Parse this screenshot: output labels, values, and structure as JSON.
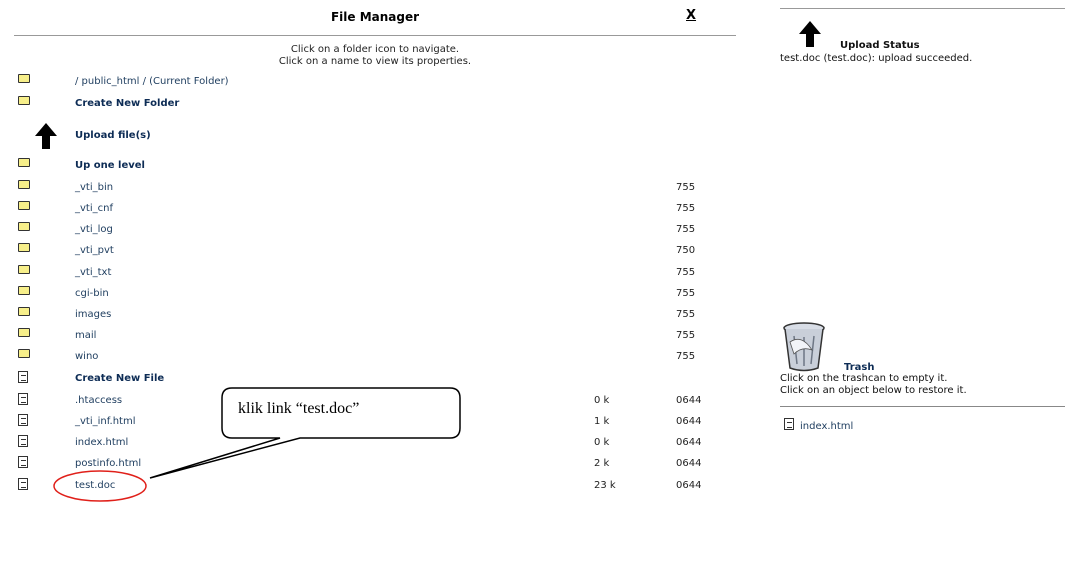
{
  "window": {
    "title": "File Manager",
    "close_label": "X"
  },
  "instructions": {
    "line1": "Click on a folder icon to navigate.",
    "line2": "Click on a name to view its properties."
  },
  "current_folder": "/ public_html / (Current Folder)",
  "actions": {
    "create_folder": "Create New Folder",
    "upload": "Upload file(s)",
    "up_level": "Up one level",
    "create_file": "Create New File"
  },
  "folders": [
    {
      "name": "_vti_bin",
      "perm": "755"
    },
    {
      "name": "_vti_cnf",
      "perm": "755"
    },
    {
      "name": "_vti_log",
      "perm": "755"
    },
    {
      "name": "_vti_pvt",
      "perm": "750"
    },
    {
      "name": "_vti_txt",
      "perm": "755"
    },
    {
      "name": "cgi-bin",
      "perm": "755"
    },
    {
      "name": "images",
      "perm": "755"
    },
    {
      "name": "mail",
      "perm": "755"
    },
    {
      "name": "wino",
      "perm": "755"
    }
  ],
  "files": [
    {
      "name": ".htaccess",
      "size": "0 k",
      "perm": "0644"
    },
    {
      "name": "_vti_inf.html",
      "size": "1 k",
      "perm": "0644"
    },
    {
      "name": "index.html",
      "size": "0 k",
      "perm": "0644"
    },
    {
      "name": "postinfo.html",
      "size": "2 k",
      "perm": "0644"
    },
    {
      "name": "test.doc",
      "size": "23 k",
      "perm": "0644"
    }
  ],
  "upload_status": {
    "title": "Upload Status",
    "message": "test.doc (test.doc): upload succeeded."
  },
  "trash": {
    "title": "Trash",
    "line1": "Click on the trashcan to empty it.",
    "line2": "Click on an object below to restore it.",
    "items": [
      "index.html"
    ]
  },
  "annotation": {
    "callout_text": "klik link “test.doc”",
    "highlight_color": "#e0201a"
  },
  "icons": {
    "folder": "folder-icon",
    "file": "file-icon",
    "upload": "up-arrow-icon",
    "trash": "trashcan-icon"
  }
}
